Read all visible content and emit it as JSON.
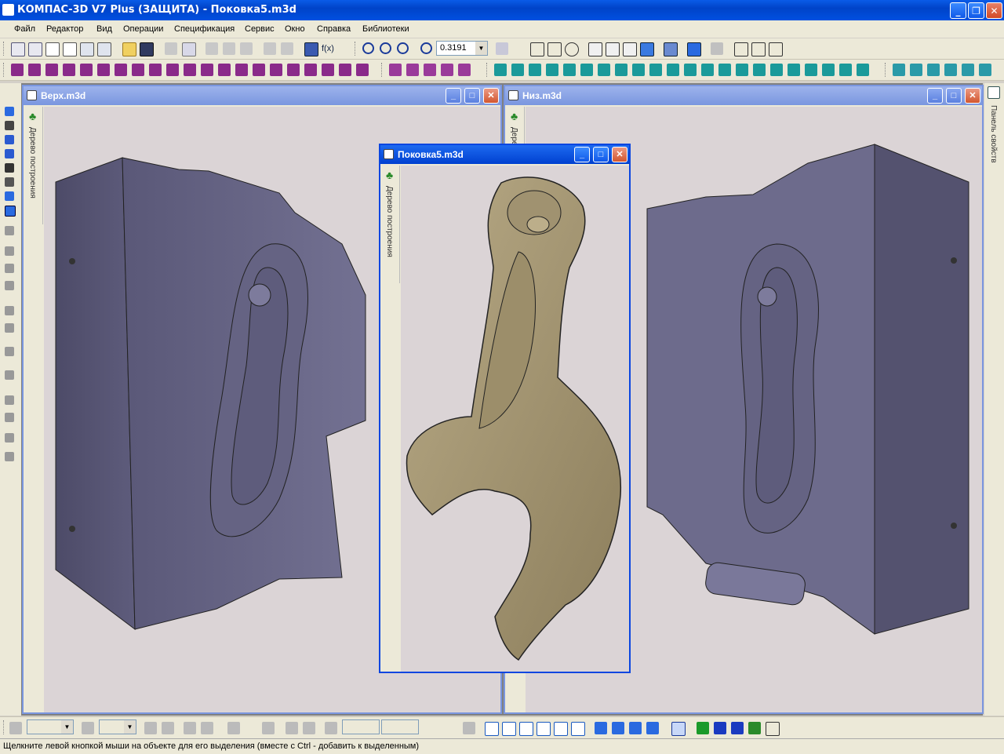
{
  "window": {
    "title": "КОМПАС-3D V7 Plus (ЗАЩИТА) - Поковка5.m3d"
  },
  "menu": [
    "Файл",
    "Редактор",
    "Вид",
    "Операции",
    "Спецификация",
    "Сервис",
    "Окно",
    "Справка",
    "Библиотеки"
  ],
  "toolbar": {
    "zoom_value": "0.3191"
  },
  "windows": {
    "top": {
      "title": "Верх.m3d",
      "tree_label": "Дерево построения"
    },
    "bottom": {
      "title": "Низ.m3d",
      "tree_label": "Дерево построения"
    },
    "forging": {
      "title": "Поковка5.m3d",
      "tree_label": "Дерево построения"
    }
  },
  "right_panel": {
    "label": "Панель свойств"
  },
  "status": {
    "text": "Щелкните левой кнопкой мыши на объекте для его выделения (вместе с Ctrl - добавить к выделенным)"
  },
  "colors": {
    "accent": "#0a46e0",
    "mold": "#6e6c90",
    "forging": "#aea07c",
    "viewport_bg": "#dbd4d6"
  }
}
